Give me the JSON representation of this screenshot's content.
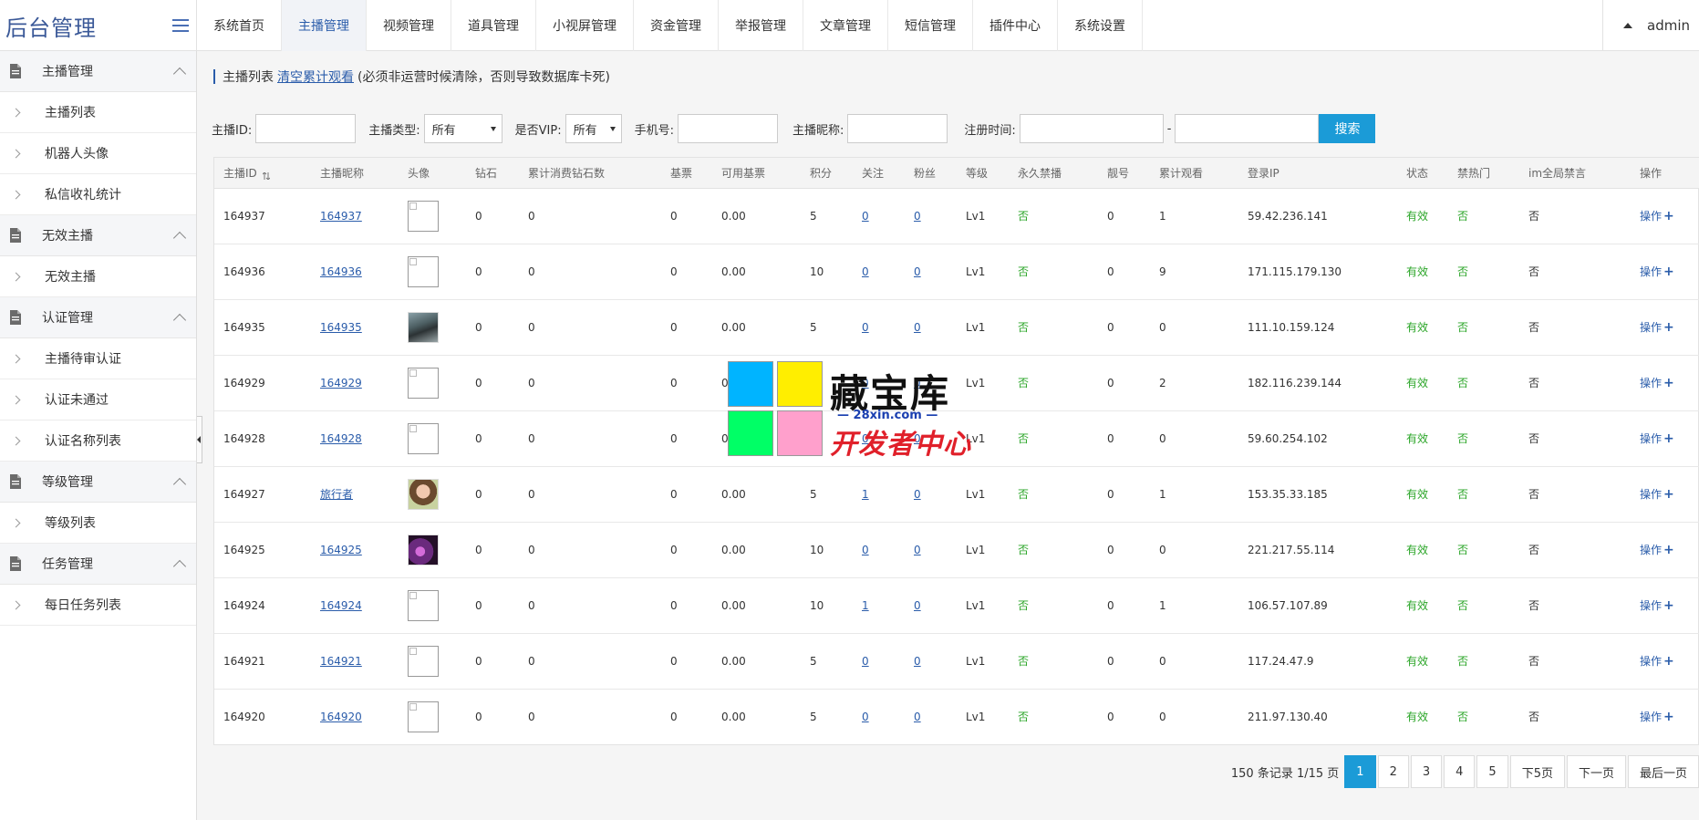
{
  "header": {
    "brand": "后台管理",
    "nav": [
      "系统首页",
      "主播管理",
      "视频管理",
      "道具管理",
      "小视屏管理",
      "资金管理",
      "举报管理",
      "文章管理",
      "短信管理",
      "插件中心",
      "系统设置"
    ],
    "active_nav": "主播管理",
    "user": "admin"
  },
  "sidebar": {
    "groups": [
      {
        "label": "主播管理",
        "items": [
          "主播列表",
          "机器人头像",
          "私信收礼统计"
        ]
      },
      {
        "label": "无效主播",
        "items": [
          "无效主播"
        ]
      },
      {
        "label": "认证管理",
        "items": [
          "主播待审认证",
          "认证未通过",
          "认证名称列表"
        ]
      },
      {
        "label": "等级管理",
        "items": [
          "等级列表"
        ]
      },
      {
        "label": "任务管理",
        "items": [
          "每日任务列表"
        ]
      }
    ]
  },
  "page": {
    "title": "主播列表",
    "clear_link": "清空累计观看",
    "note": "(必须非运营时候清除，否则导致数据库卡死)"
  },
  "filters": {
    "anchor_id_label": "主播ID:",
    "anchor_type_label": "主播类型:",
    "anchor_type_value": "所有",
    "vip_label": "是否VIP:",
    "vip_value": "所有",
    "phone_label": "手机号:",
    "nickname_label": "主播昵称:",
    "reg_time_label": "注册时间:",
    "range_sep": "-",
    "search_button": "搜索"
  },
  "table": {
    "columns": [
      "主播ID",
      "主播昵称",
      "头像",
      "钻石",
      "累计消费钻石数",
      "基票",
      "可用基票",
      "积分",
      "关注",
      "粉丝",
      "等级",
      "永久禁播",
      "靓号",
      "累计观看",
      "登录IP",
      "状态",
      "禁热门",
      "im全局禁言",
      "操作"
    ],
    "rows": [
      {
        "id": "164937",
        "nick": "164937",
        "avatar": "broken",
        "diamond": "0",
        "spent": "0",
        "ticket": "0",
        "avail": "0.00",
        "points": "5",
        "follow": "0",
        "fans": "0",
        "level": "Lv1",
        "ban": "否",
        "pretty": "0",
        "views": "1",
        "ip": "59.42.236.141",
        "status": "有效",
        "hot": "否",
        "mute": "否",
        "op": "操作"
      },
      {
        "id": "164936",
        "nick": "164936",
        "avatar": "broken",
        "diamond": "0",
        "spent": "0",
        "ticket": "0",
        "avail": "0.00",
        "points": "10",
        "follow": "0",
        "fans": "0",
        "level": "Lv1",
        "ban": "否",
        "pretty": "0",
        "views": "9",
        "ip": "171.115.179.130",
        "status": "有效",
        "hot": "否",
        "mute": "否",
        "op": "操作"
      },
      {
        "id": "164935",
        "nick": "164935",
        "avatar": "man",
        "diamond": "0",
        "spent": "0",
        "ticket": "0",
        "avail": "0.00",
        "points": "5",
        "follow": "0",
        "fans": "0",
        "level": "Lv1",
        "ban": "否",
        "pretty": "0",
        "views": "0",
        "ip": "111.10.159.124",
        "status": "有效",
        "hot": "否",
        "mute": "否",
        "op": "操作"
      },
      {
        "id": "164929",
        "nick": "164929",
        "avatar": "broken",
        "diamond": "0",
        "spent": "0",
        "ticket": "0",
        "avail": "0.00",
        "points": "5",
        "follow": "0",
        "fans": "0",
        "level": "Lv1",
        "ban": "否",
        "pretty": "0",
        "views": "2",
        "ip": "182.116.239.144",
        "status": "有效",
        "hot": "否",
        "mute": "否",
        "op": "操作"
      },
      {
        "id": "164928",
        "nick": "164928",
        "avatar": "broken",
        "diamond": "0",
        "spent": "0",
        "ticket": "0",
        "avail": "0.00",
        "points": "5",
        "follow": "0",
        "fans": "0",
        "level": "Lv1",
        "ban": "否",
        "pretty": "0",
        "views": "0",
        "ip": "59.60.254.102",
        "status": "有效",
        "hot": "否",
        "mute": "否",
        "op": "操作"
      },
      {
        "id": "164927",
        "nick": "旅行者",
        "avatar": "woman",
        "diamond": "0",
        "spent": "0",
        "ticket": "0",
        "avail": "0.00",
        "points": "5",
        "follow": "1",
        "fans": "0",
        "level": "Lv1",
        "ban": "否",
        "pretty": "0",
        "views": "1",
        "ip": "153.35.33.185",
        "status": "有效",
        "hot": "否",
        "mute": "否",
        "op": "操作"
      },
      {
        "id": "164925",
        "nick": "164925",
        "avatar": "purple",
        "diamond": "0",
        "spent": "0",
        "ticket": "0",
        "avail": "0.00",
        "points": "10",
        "follow": "0",
        "fans": "0",
        "level": "Lv1",
        "ban": "否",
        "pretty": "0",
        "views": "0",
        "ip": "221.217.55.114",
        "status": "有效",
        "hot": "否",
        "mute": "否",
        "op": "操作"
      },
      {
        "id": "164924",
        "nick": "164924",
        "avatar": "broken",
        "diamond": "0",
        "spent": "0",
        "ticket": "0",
        "avail": "0.00",
        "points": "10",
        "follow": "1",
        "fans": "0",
        "level": "Lv1",
        "ban": "否",
        "pretty": "0",
        "views": "1",
        "ip": "106.57.107.89",
        "status": "有效",
        "hot": "否",
        "mute": "否",
        "op": "操作"
      },
      {
        "id": "164921",
        "nick": "164921",
        "avatar": "broken",
        "diamond": "0",
        "spent": "0",
        "ticket": "0",
        "avail": "0.00",
        "points": "5",
        "follow": "0",
        "fans": "0",
        "level": "Lv1",
        "ban": "否",
        "pretty": "0",
        "views": "0",
        "ip": "117.24.47.9",
        "status": "有效",
        "hot": "否",
        "mute": "否",
        "op": "操作"
      },
      {
        "id": "164920",
        "nick": "164920",
        "avatar": "broken",
        "diamond": "0",
        "spent": "0",
        "ticket": "0",
        "avail": "0.00",
        "points": "5",
        "follow": "0",
        "fans": "0",
        "level": "Lv1",
        "ban": "否",
        "pretty": "0",
        "views": "0",
        "ip": "211.97.130.40",
        "status": "有效",
        "hot": "否",
        "mute": "否",
        "op": "操作"
      }
    ]
  },
  "pagination": {
    "info": "150 条记录 1/15 页",
    "pages": [
      "1",
      "2",
      "3",
      "4",
      "5"
    ],
    "active_page": "1",
    "next5": "下5页",
    "next": "下一页",
    "last": "最后一页"
  },
  "watermark": {
    "top": "藏宝库",
    "url": "— 28xin.com —",
    "bottom": "开发者中心",
    "colors": [
      "#00b4ff",
      "#ffee00",
      "#00ff66",
      "#ffa0cc"
    ]
  }
}
